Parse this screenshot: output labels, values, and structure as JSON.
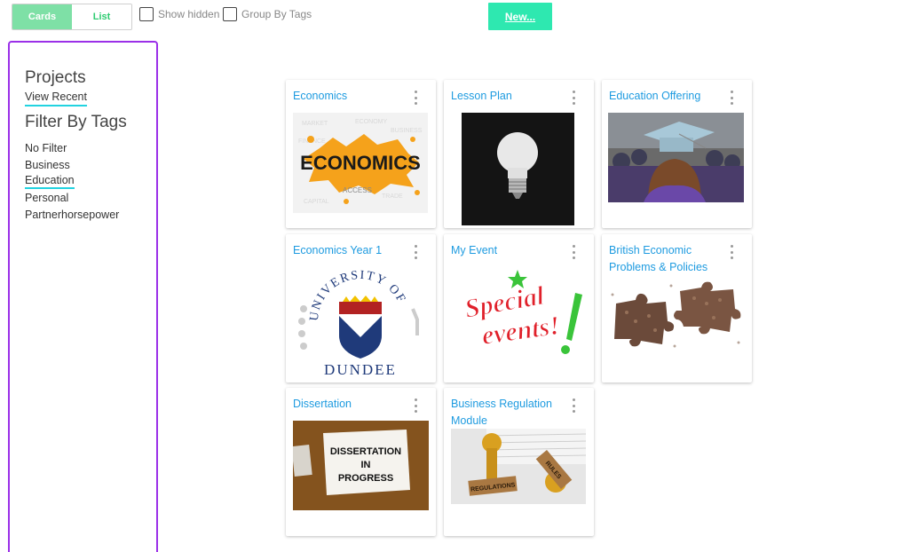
{
  "toolbar": {
    "view_toggle": {
      "cards_label": "Cards",
      "list_label": "List",
      "active": "Cards"
    },
    "show_hidden_label": "Show hidden",
    "group_by_tags_label": "Group By Tags",
    "new_button_label": "New..."
  },
  "sidebar": {
    "projects_heading": "Projects",
    "view_recent_label": "View Recent",
    "filter_heading": "Filter By Tags",
    "tags": [
      "No Filter",
      "Business",
      "Education",
      "Personal",
      "Partnerhorsepower"
    ],
    "selected_tag": "Education"
  },
  "cards": [
    {
      "title": "Economics",
      "image": "economics-paint-splash"
    },
    {
      "title": "Lesson Plan",
      "image": "light-bulb"
    },
    {
      "title": "Education Offering",
      "image": "graduation-cap"
    },
    {
      "title": "Economics Year 1",
      "image": "university-of-dundee-logo",
      "image_text": {
        "arc": "UNIVERSITY OF",
        "bottom": "DUNDEE"
      }
    },
    {
      "title": "My Event",
      "image": "special-events-logo",
      "image_text": {
        "line1": "Special",
        "line2": "events!"
      }
    },
    {
      "title": "British Economic Problems & Policies",
      "image": "puzzle-pieces"
    },
    {
      "title": "Dissertation",
      "image": "dissertation-sign",
      "image_text": {
        "line1": "DISSERTATION",
        "line2": "IN",
        "line3": "PROGRESS"
      }
    },
    {
      "title": "Business Regulation Module",
      "image": "regulation-stamps",
      "image_text": {
        "stamp1": "REGULATIONS",
        "stamp2": "RULES"
      }
    }
  ],
  "colors": {
    "accent_green": "#2ee8b0",
    "toggle_active": "#7ee0a6",
    "link_blue": "#1e9be0",
    "sidebar_border": "#9b30e8",
    "underline": "#22d3e0"
  }
}
